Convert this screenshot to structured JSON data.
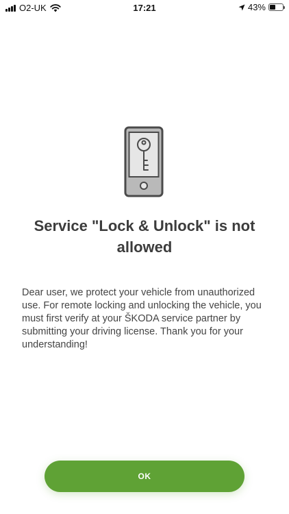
{
  "status_bar": {
    "carrier": "O2-UK",
    "time": "17:21",
    "battery": "43%",
    "battery_level": 0.43,
    "icons": [
      "signal-icon",
      "wifi-icon",
      "location-arrow-icon",
      "battery-icon"
    ]
  },
  "dialog": {
    "icon": "phone-key-icon",
    "title": "Service \"Lock & Unlock\" is not allowed",
    "message": "Dear user, we protect your vehicle from unauthorized use. For remote locking and unlocking the vehicle, you must first verify at your ŠKODA service partner by submitting your driving license. Thank you for your understanding!",
    "ok_label": "OK"
  },
  "colors": {
    "accent": "#5fa235",
    "icon_outline": "#4a4a4a",
    "icon_screen": "#e6e6e6",
    "icon_body": "#b9b9b9",
    "text": "#3c3c3c"
  }
}
